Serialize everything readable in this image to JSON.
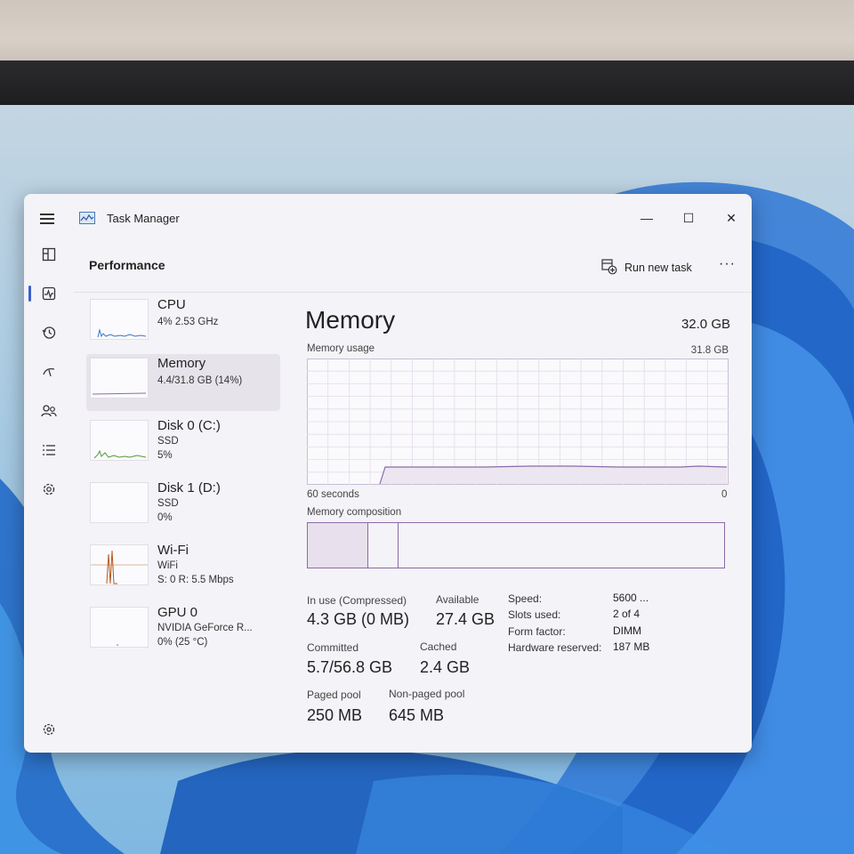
{
  "window": {
    "title": "Task Manager",
    "minimize": "—",
    "maximize": "☐",
    "close": "✕"
  },
  "header": {
    "title": "Performance",
    "run_new_task": "Run new task",
    "more": "···"
  },
  "sidebar": {
    "icons": [
      "menu-icon",
      "processes-icon",
      "performance-icon",
      "app-history-icon",
      "startup-apps-icon",
      "users-icon",
      "details-icon",
      "services-icon",
      "settings-icon"
    ]
  },
  "devices": [
    {
      "name": "CPU",
      "line1": "4% 2.53 GHz",
      "line2": "",
      "line3": ""
    },
    {
      "name": "Memory",
      "line1": "4.4/31.8 GB (14%)",
      "line2": "",
      "line3": ""
    },
    {
      "name": "Disk 0 (C:)",
      "line1": "SSD",
      "line2": "5%",
      "line3": ""
    },
    {
      "name": "Disk 1 (D:)",
      "line1": "SSD",
      "line2": "0%",
      "line3": ""
    },
    {
      "name": "Wi-Fi",
      "line1": "WiFi",
      "line2": "S: 0 R: 5.5 Mbps",
      "line3": ""
    },
    {
      "name": "GPU 0",
      "line1": "NVIDIA GeForce R...",
      "line2": "0% (25 °C)",
      "line3": ""
    }
  ],
  "memory": {
    "title": "Memory",
    "capacity": "32.0 GB",
    "usage_label": "Memory usage",
    "usage_max": "31.8 GB",
    "time_label": "60 seconds",
    "time_zero": "0",
    "composition_label": "Memory composition",
    "stats": {
      "in_use_label": "In use (Compressed)",
      "in_use_value": "4.3 GB (0 MB)",
      "available_label": "Available",
      "available_value": "27.4 GB",
      "committed_label": "Committed",
      "committed_value": "5.7/56.8 GB",
      "cached_label": "Cached",
      "cached_value": "2.4 GB",
      "paged_label": "Paged pool",
      "paged_value": "250 MB",
      "nonpaged_label": "Non-paged pool",
      "nonpaged_value": "645 MB"
    },
    "details": [
      {
        "key": "Speed:",
        "value": "5600 ..."
      },
      {
        "key": "Slots used:",
        "value": "2 of 4"
      },
      {
        "key": "Form factor:",
        "value": "DIMM"
      },
      {
        "key": "Hardware reserved:",
        "value": "187 MB"
      }
    ],
    "usage_fraction": 0.14
  },
  "colors": {
    "accent": "#3a60c8",
    "memory_line": "#8b6ba9",
    "window_bg": "#f4f3f7"
  }
}
